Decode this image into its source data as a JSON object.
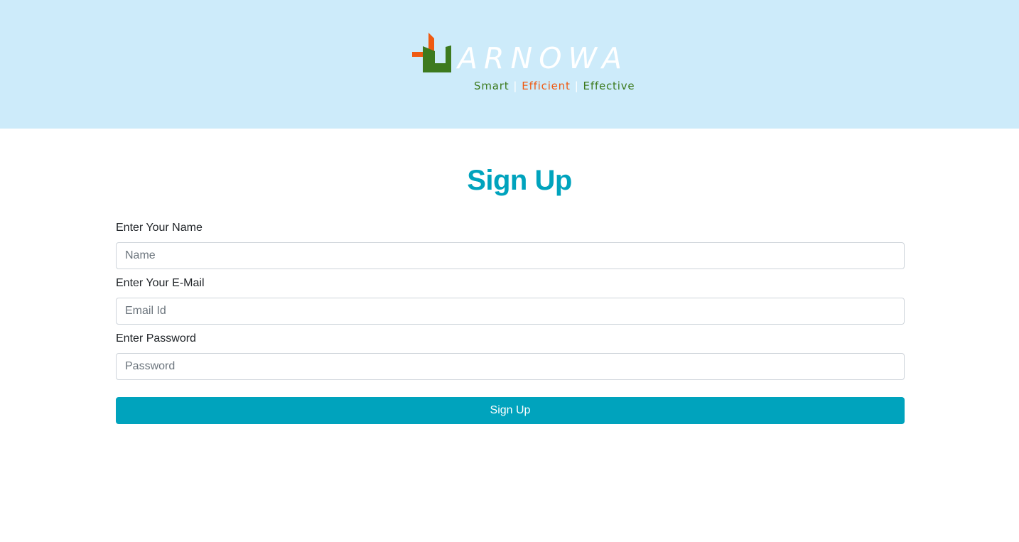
{
  "brand": {
    "name": "ARNOWA",
    "tagline": {
      "word1": "Smart",
      "word2": "Efficient",
      "word3": "Effective",
      "separator": "|"
    },
    "colors": {
      "orange": "#ef5a12",
      "green": "#3d7a1e",
      "header_bg": "#cdebfa"
    }
  },
  "page": {
    "title": "Sign Up"
  },
  "form": {
    "name": {
      "label": "Enter Your Name",
      "placeholder": "Name",
      "value": ""
    },
    "email": {
      "label": "Enter Your E-Mail",
      "placeholder": "Email Id",
      "value": ""
    },
    "password": {
      "label": "Enter Password",
      "placeholder": "Password",
      "value": ""
    },
    "submit_label": "Sign Up"
  },
  "theme": {
    "accent": "#00a3bd"
  }
}
